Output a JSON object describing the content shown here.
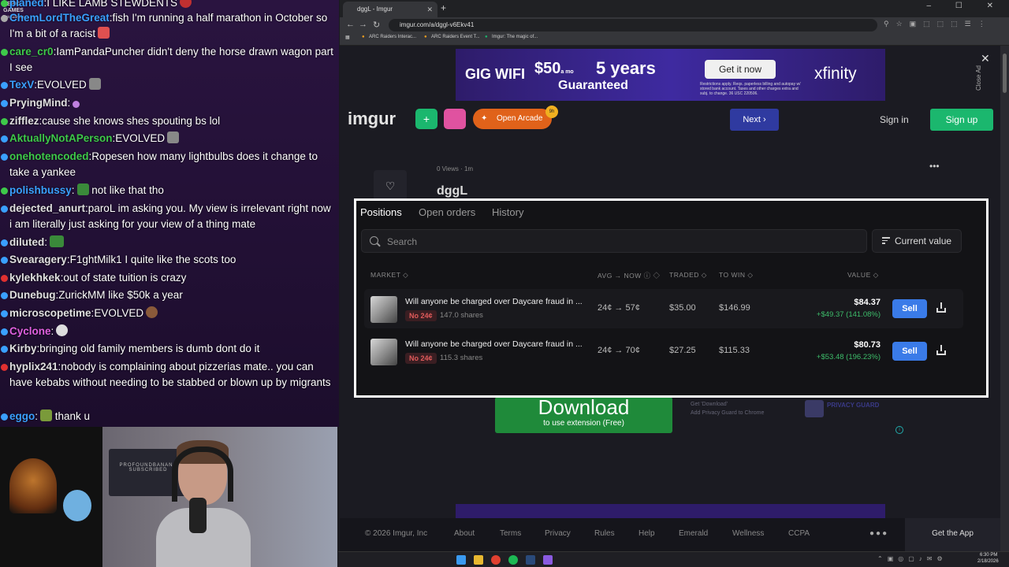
{
  "chat": {
    "lines": [
      {
        "user": "planed",
        "msg": "I LIKE LAMB STEWDENTS",
        "color": "#e0e0e0"
      },
      {
        "user": "ChemLordTheGreat",
        "msg": "fish I'm running a half marathon in October so I'm a bit of a racist",
        "color": "#e0e0e0"
      },
      {
        "user": "care_cr0",
        "msg": "IamPandaPuncher didn't deny the horse drawn wagon part I see",
        "color": "#3ec94a"
      },
      {
        "user": "TexV",
        "msg": "EVOLVED",
        "color": "#3aa0ff"
      },
      {
        "user": "PryingMind",
        "msg": "",
        "color": "#e0e0e0"
      },
      {
        "user": "zifflez",
        "msg": "cause she knows shes spouting bs lol",
        "color": "#e0e0e0"
      },
      {
        "user": "AktuallyNotAPerson",
        "msg": "EVOLVED",
        "color": "#3ec94a"
      },
      {
        "user": "onehotencoded",
        "msg": "Ropesen how many lightbulbs does it change to take a yankee",
        "color": "#3ec94a"
      },
      {
        "user": "polishbussy",
        "msg": " not like that tho",
        "color": "#3aa0ff"
      },
      {
        "user": "dejected_anurt",
        "msg": "paroL im asking you. My view is irrelevant right now i am literally just asking for your view of a thing mate",
        "color": "#e0e0e0"
      },
      {
        "user": "diluted",
        "msg": "",
        "color": "#e0e0e0"
      },
      {
        "user": "Svearagery",
        "msg": "F1ghtMilk1  I quite like the scots too",
        "color": "#e0e0e0"
      },
      {
        "user": "kylekhkek",
        "msg": "out of state tuition is crazy",
        "color": "#e0e0e0"
      },
      {
        "user": "Dunebug",
        "msg": "ZurickMM like $50k a year",
        "color": "#e0e0e0"
      },
      {
        "user": "microscopetime",
        "msg": "EVOLVED",
        "color": "#e0e0e0"
      },
      {
        "user": "Cyclone",
        "msg": "",
        "color": "#e060e0"
      },
      {
        "user": "Kirby",
        "msg": "bringing old family members is dumb dont do it",
        "color": "#e0e0e0"
      },
      {
        "user": "hyplix241",
        "msg": "nobody is complaining about pizzerias mate.. you can have kebabs without needing to be stabbed or blown up by migrants",
        "color": "#e0e0e0"
      },
      {
        "user": "eggo",
        "msg": " thank u",
        "color": "#3aa0ff"
      }
    ],
    "epic_logo": "EPIC GAMES",
    "epic_caption": "Epic Games"
  },
  "webcam": {
    "sign_text": "PROFOUNDBANANA SUBSCRIBED"
  },
  "browser": {
    "tab_title": "dggL - Imgur",
    "url": "imgur.com/a/dggl-v6Ekv41",
    "bookmarks": [
      "ARC Raiders Interac...",
      "ARC Raiders Event T...",
      "Imgur: The magic of..."
    ],
    "controls": "–  ☐  ✕"
  },
  "ad": {
    "gig": "GIG WIFI",
    "price": "$50",
    "price_suffix": "a mo",
    "years": "5 years",
    "guaranteed": "Guaranteed",
    "cta": "Get it now",
    "small": "Restrictions apply. Reqs. paperless billing and autopay w/ stored bank account. Taxes and other charges extra and subj. to change. 36 USC 220506.",
    "brand": "xfinity",
    "close_ad": "Close Ad"
  },
  "imgur": {
    "logo": "imgur",
    "arcade": "Open Arcade",
    "arcade_badge": "9h",
    "next": "Next",
    "signin": "Sign in",
    "signup": "Sign up",
    "meta": "0 Views · 1m",
    "title": "dggL",
    "download_title": "Download",
    "download_sub": "to use extension (Free)",
    "download_side": "Get 'Download'",
    "download_side2": "Add Privacy Guard to Chrome",
    "privacy_guard": "PRIVACY GUARD"
  },
  "footer": {
    "copyright": "© 2026 Imgur, Inc",
    "links": [
      "About",
      "Terms",
      "Privacy",
      "Rules",
      "Help",
      "Emerald",
      "Wellness",
      "CCPA"
    ],
    "get_app": "Get the App"
  },
  "positions": {
    "tabs": [
      "Positions",
      "Open orders",
      "History"
    ],
    "search_placeholder": "Search",
    "sort_label": "Current value",
    "columns": {
      "market": "MARKET ◇",
      "avgnow": "AVG → NOW ⓘ ◇",
      "traded": "TRADED ◇",
      "towin": "TO WIN ◇",
      "value": "VALUE ◇"
    },
    "rows": [
      {
        "title": "Will anyone be charged over Daycare fraud in ...",
        "outcome": "No 24¢",
        "shares": "147.0 shares",
        "avgnow": "24¢ → 57¢",
        "traded": "$35.00",
        "towin": "$146.99",
        "value": "$84.37",
        "pnl": "+$49.37 (141.08%)",
        "sell": "Sell"
      },
      {
        "title": "Will anyone be charged over Daycare fraud in ...",
        "outcome": "No 24¢",
        "shares": "115.3 shares",
        "avgnow": "24¢ → 70¢",
        "traded": "$27.25",
        "towin": "$115.33",
        "value": "$80.73",
        "pnl": "+$53.48 (196.23%)",
        "sell": "Sell"
      }
    ]
  },
  "taskbar": {
    "time": "6:30 PM",
    "date": "2/18/2026"
  }
}
